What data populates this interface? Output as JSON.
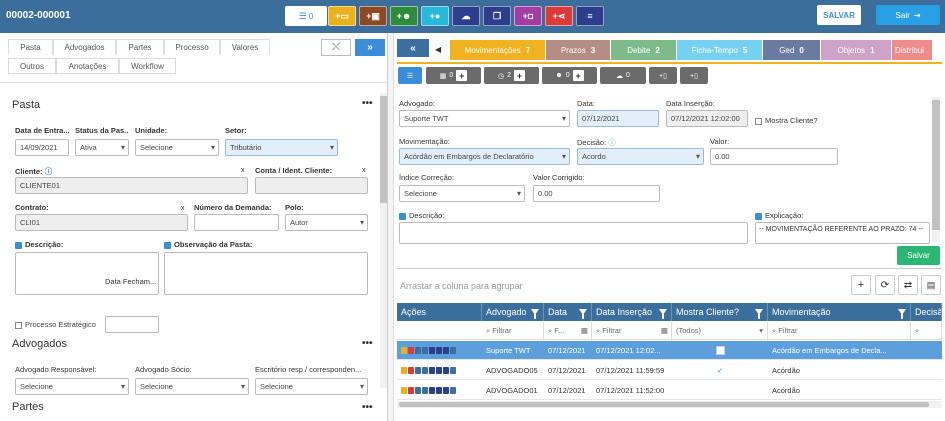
{
  "header": {
    "case_id": "00002-000001",
    "list_count": "0",
    "save_label": "SALVAR",
    "exit_label": "Sair",
    "action_buttons": [
      {
        "icon": "plus-card-icon",
        "color": "#e8b21d"
      },
      {
        "icon": "plus-briefcase-icon",
        "color": "#8b4a22"
      },
      {
        "icon": "plus-user-icon",
        "color": "#2e8b3d"
      },
      {
        "icon": "plus-circle-icon",
        "color": "#27b8dc"
      },
      {
        "icon": "cloud-upload-icon",
        "color": "#2c3e8c"
      },
      {
        "icon": "copy-icon",
        "color": "#2c3e8c"
      },
      {
        "icon": "plus-square-icon",
        "color": "#a33ea1"
      },
      {
        "icon": "share-icon",
        "color": "#d93a3a"
      },
      {
        "icon": "menu-icon",
        "color": "#2c3e8c"
      }
    ]
  },
  "left_tabs": [
    "Pasta",
    "Advogados",
    "Partes",
    "Processo",
    "Valores",
    "Outros",
    "Anotações",
    "Workflow"
  ],
  "pasta": {
    "title": "Pasta",
    "data_entrada_label": "Data de Entra...",
    "data_entrada": "14/09/2021",
    "status_label": "Status da Pas...",
    "status": "Ativa",
    "unidade_label": "Unidade:",
    "unidade": "Selecione",
    "setor_label": "Setor:",
    "setor": "Tributário",
    "cliente_label": "Cliente:",
    "cliente": "CLIENTE01",
    "conta_label": "Conta / Ident. Cliente:",
    "contrato_label": "Contrato:",
    "contrato": "CLI01",
    "numero_demanda_label": "Número da Demanda:",
    "polo_label": "Polo:",
    "polo": "Autor",
    "descricao_label": "Descrição:",
    "observacao_label": "Observação da Pasta:",
    "data_fechamento_label": "Data Fecham...",
    "processo_estrategico_label": "Processo Estratégico"
  },
  "advogados": {
    "title": "Advogados",
    "responsavel_label": "Advogado Responsável:",
    "responsavel": "Selecione",
    "socio_label": "Advogado Sócio:",
    "socio": "Selecione",
    "escritorio_label": "Escritório resp / corresponden...",
    "escritorio": "Selecione"
  },
  "partes": {
    "title": "Partes"
  },
  "right_tabs": [
    {
      "label": "Movimentações",
      "count": "7",
      "color": "#f0b21e"
    },
    {
      "label": "Prazos",
      "count": "3",
      "color": "#b48d84"
    },
    {
      "label": "Debite",
      "count": "2",
      "color": "#7dbb8b"
    },
    {
      "label": "Ficha-Tempo",
      "count": "5",
      "color": "#76d1f0"
    },
    {
      "label": "Ged",
      "count": "0",
      "color": "#6b7aa1"
    },
    {
      "label": "Objetos",
      "count": "1",
      "color": "#cfa3c8"
    },
    {
      "label": "Distribui",
      "count": "",
      "color": "#ee8b8b"
    }
  ],
  "sub_toolbar": [
    {
      "icon": "calendar-icon",
      "count": "0"
    },
    {
      "icon": "clock-icon",
      "count": "2"
    },
    {
      "icon": "users-icon",
      "count": "0"
    },
    {
      "icon": "cloud-icon",
      "count": "0"
    },
    {
      "icon": "plus-doc-icon",
      "count": ""
    },
    {
      "icon": "plus-file-icon",
      "count": ""
    }
  ],
  "form": {
    "advogado_label": "Advogado:",
    "advogado": "Suporte TWT",
    "data_label": "Data:",
    "data": "07/12/2021",
    "data_insercao_label": "Data Inserção:",
    "data_insercao": "07/12/2021 12:02:00",
    "mostra_cliente_label": "Mostra Cliente?",
    "movimentacao_label": "Movimentação:",
    "movimentacao": "Acórdão em Embargos de Declaratório",
    "decisao_label": "Decisão:",
    "decisao": "Acordo",
    "valor_label": "Valor:",
    "valor": "0.00",
    "indice_label": "Índice Correção:",
    "indice": "Selecione",
    "valor_corrigido_label": "Valor Corrigido:",
    "valor_corrigido": "0.00",
    "descricao_label": "Descrição:",
    "explicacao_label": "Explicação:",
    "explicacao": "-- MOVIMENTAÇÃO REFERENTE AO PRAZO: 74 --",
    "save_label": "Salvar"
  },
  "grid": {
    "group_hint": "Arrastar a coluna para agrupar",
    "columns": [
      "Ações",
      "Advogado",
      "Data",
      "Data Inserção",
      "Mostra Cliente?",
      "Movimentação",
      "Decisã"
    ],
    "filter_placeholder": "Filtrar",
    "date_filter_placeholder": "F...",
    "todos": "(Todos)",
    "rows": [
      {
        "advogado": "Suporte TWT",
        "data": "07/12/2021",
        "data_insercao": "07/12/2021 12:02...",
        "mostra": "",
        "movimentacao": "Acórdão em Embargos de Decla..."
      },
      {
        "advogado": "ADVOGADO05",
        "data": "07/12/2021",
        "data_insercao": "07/12/2021 11:59:59",
        "mostra": "✓",
        "movimentacao": "Acórdão"
      },
      {
        "advogado": "ADVOGADO01",
        "data": "07/12/2021",
        "data_insercao": "07/12/2021 11:52:00",
        "mostra": "",
        "movimentacao": "Acórdão"
      }
    ]
  }
}
